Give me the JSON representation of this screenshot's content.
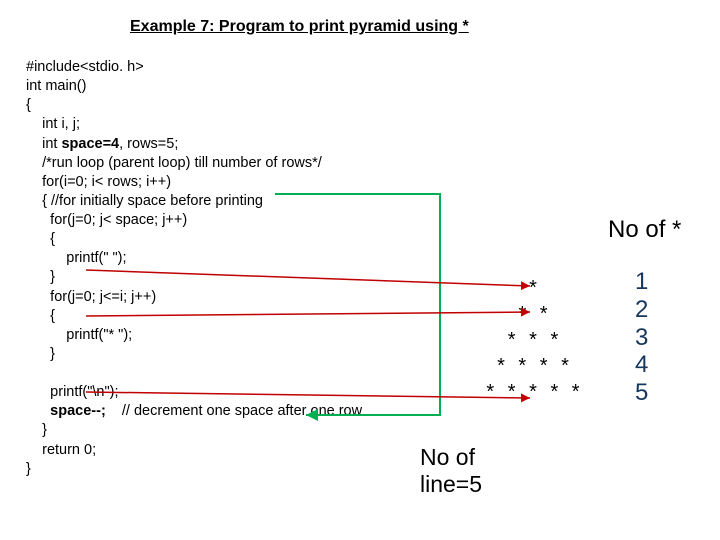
{
  "title": "Example 7: Program to print pyramid using *",
  "code": {
    "l1": "#include<stdio. h>",
    "l2": "int main()",
    "l3": "{",
    "l4": "    int i, j;",
    "l5_a": "    int ",
    "l5_b": "space=4",
    "l5_c": ", rows=5;",
    "l6": "    /*run loop (parent loop) till number of rows*/",
    "l7": "    for(i=0; i< rows; i++)",
    "l8": "    { //for initially space before printing",
    "l9": "      for(j=0; j< space; j++)",
    "l10": "      {",
    "l11": "          printf(\" \");",
    "l12": "      }",
    "l13": "      for(j=0; j<=i; j++)",
    "l14": "      {",
    "l15": "          printf(\"* \");",
    "l16": "      }",
    "l17": "      printf(\"\\n\");",
    "l18_a": "      ",
    "l18_b": "space--;",
    "l18_c": "    // decrement one space after one row",
    "l19": "    }",
    "l20": "    return 0;",
    "l21": "}"
  },
  "labels": {
    "noofstar": "No of *",
    "nooflines_l1": "No of",
    "nooflines_l2": "line=5"
  },
  "pyramid": {
    "r1": "*",
    "r2": "* *",
    "r3": "* * *",
    "r4": "* * * *",
    "r5": "* * * * *"
  },
  "numbers": {
    "n1": "1",
    "n2": "2",
    "n3": "3",
    "n4": "4",
    "n5": "5"
  }
}
